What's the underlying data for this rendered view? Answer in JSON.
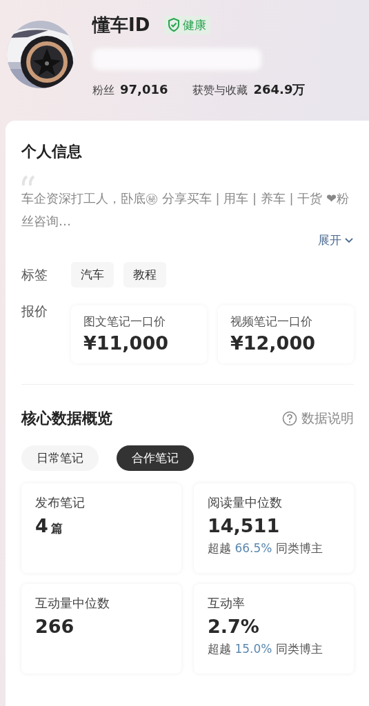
{
  "profile": {
    "name": "懂车ID",
    "badge": "健康",
    "stats": [
      {
        "label": "粉丝",
        "value": "97,016"
      },
      {
        "label": "获赞与收藏",
        "value": "264.9万"
      }
    ]
  },
  "info": {
    "title": "个人信息",
    "bio": "车企资深打工人，卧底㊙ 分享买车 | 用车 | 养车 | 干货 ❤粉丝咨询…",
    "expand": "展开",
    "tags_label": "标签",
    "tags": [
      "汽车",
      "教程"
    ],
    "price_label": "报价",
    "prices": [
      {
        "label": "图文笔记一口价",
        "value": "¥11,000"
      },
      {
        "label": "视频笔记一口价",
        "value": "¥12,000"
      }
    ]
  },
  "overview": {
    "title": "核心数据概览",
    "help": "数据说明",
    "tabs": [
      {
        "label": "日常笔记",
        "selected": false
      },
      {
        "label": "合作笔记",
        "selected": true
      }
    ],
    "stats": [
      {
        "label": "发布笔记",
        "value": "4",
        "unit": "篇"
      },
      {
        "label": "阅读量中位数",
        "value": "14,511",
        "compare": {
          "prefix": "超越",
          "percent": "66.5%",
          "suffix": "同类博主"
        }
      },
      {
        "label": "互动量中位数",
        "value": "266"
      },
      {
        "label": "互动率",
        "value": "2.7%",
        "compare": {
          "prefix": "超越",
          "percent": "15.0%",
          "suffix": "同类博主"
        }
      }
    ]
  }
}
